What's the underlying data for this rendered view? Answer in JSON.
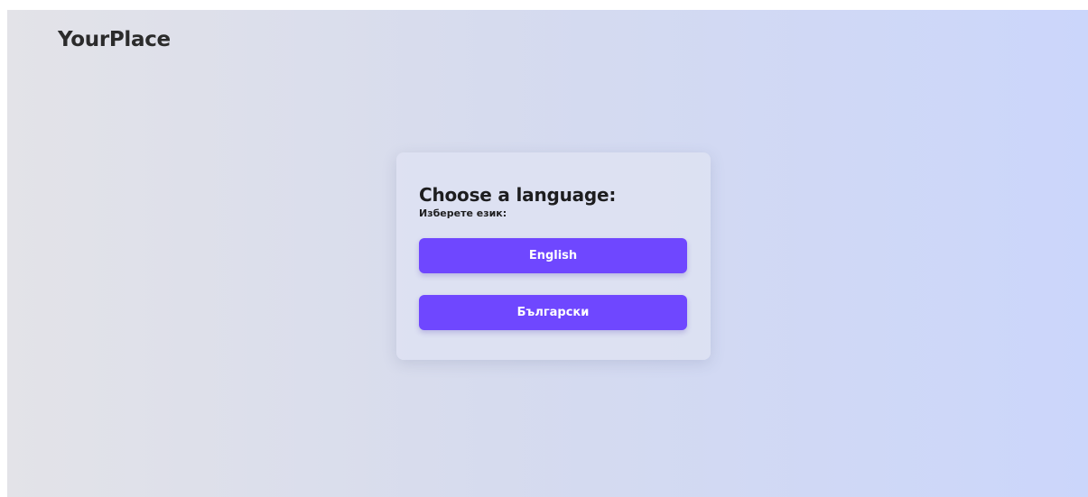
{
  "header": {
    "logo_text": "YourPlace"
  },
  "language_card": {
    "title": "Choose a language:",
    "subtitle": "Изберете език:",
    "options": [
      {
        "label": "English"
      },
      {
        "label": "Български"
      }
    ]
  },
  "colors": {
    "accent": "#6f47ff",
    "card_background": "#dee2f2",
    "gradient_start": "#e3e3e8",
    "gradient_end": "#cbd6fb",
    "text": "#1d1d1f"
  }
}
